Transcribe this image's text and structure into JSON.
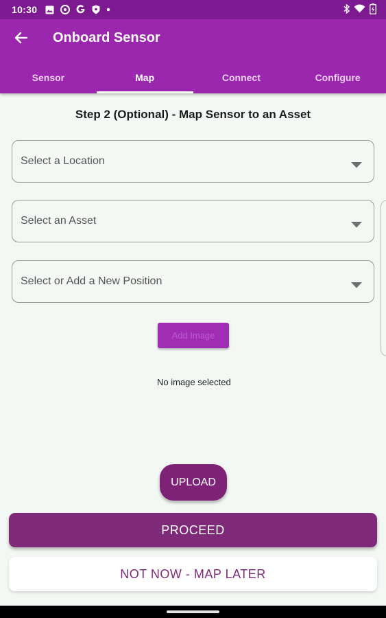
{
  "status_bar": {
    "time": "10:30",
    "icons_left": [
      "image-icon",
      "vpn-icon",
      "google-icon",
      "shield-icon",
      "dot-icon"
    ],
    "icons_right": [
      "bluetooth-icon",
      "wifi-icon",
      "battery-charging-icon"
    ]
  },
  "app_bar": {
    "title": "Onboard Sensor",
    "back_icon": "arrow-back-icon",
    "tabs": [
      {
        "label": "Sensor",
        "active": false
      },
      {
        "label": "Map",
        "active": true
      },
      {
        "label": "Connect",
        "active": false
      },
      {
        "label": "Configure",
        "active": false
      }
    ]
  },
  "main": {
    "step_title": "Step 2 (Optional) - Map Sensor to an Asset",
    "location_dropdown": {
      "value": "Select a Location"
    },
    "asset_dropdown": {
      "value": "Select an Asset"
    },
    "position_dropdown": {
      "value": "Select or Add a New Position"
    },
    "add_image_label": "Add Image",
    "no_image_text": "No image selected",
    "upload_label": "UPLOAD",
    "proceed_label": "PROCEED",
    "map_later_label": "NOT NOW - MAP LATER"
  },
  "colors": {
    "status_bar": "#7e1a91",
    "app_bar": "#9b27af",
    "primary_button": "#7e2a79",
    "background": "#f4f8f4"
  }
}
